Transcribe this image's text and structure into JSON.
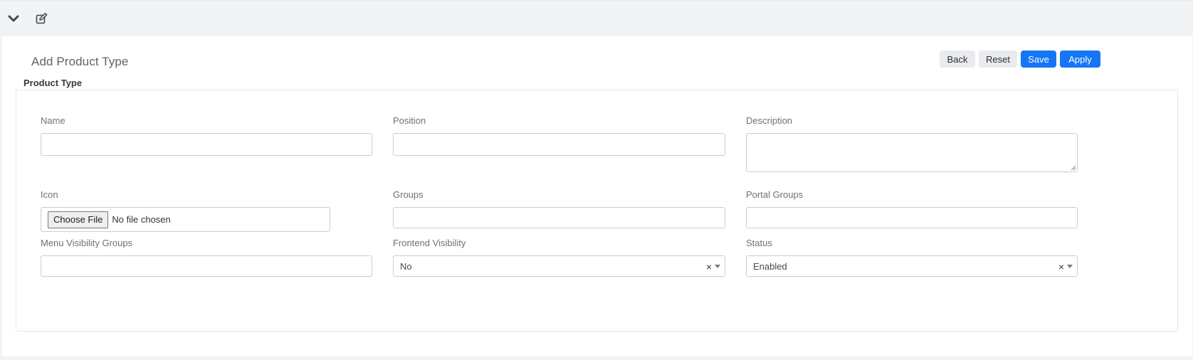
{
  "toolbar": {
    "collapse_icon": "chevron-down-icon",
    "edit_icon": "edit-icon"
  },
  "header": {
    "title": "Add Product Type",
    "buttons": {
      "back": "Back",
      "reset": "Reset",
      "save": "Save",
      "apply": "Apply"
    }
  },
  "section": {
    "title": "Product Type"
  },
  "form": {
    "name": {
      "label": "Name",
      "value": ""
    },
    "position": {
      "label": "Position",
      "value": ""
    },
    "description": {
      "label": "Description",
      "value": ""
    },
    "icon": {
      "label": "Icon",
      "button": "Choose File",
      "status": "No file chosen"
    },
    "groups": {
      "label": "Groups",
      "value": ""
    },
    "portal_groups": {
      "label": "Portal Groups",
      "value": ""
    },
    "menu_visibility_groups": {
      "label": "Menu Visibility Groups",
      "value": ""
    },
    "frontend_visibility": {
      "label": "Frontend Visibility",
      "value": "No",
      "clear": "×"
    },
    "status": {
      "label": "Status",
      "value": "Enabled",
      "clear": "×"
    }
  },
  "colors": {
    "primary": "#1476f5",
    "light_button": "#e9ebee",
    "page_background": "#f2f3f5"
  }
}
